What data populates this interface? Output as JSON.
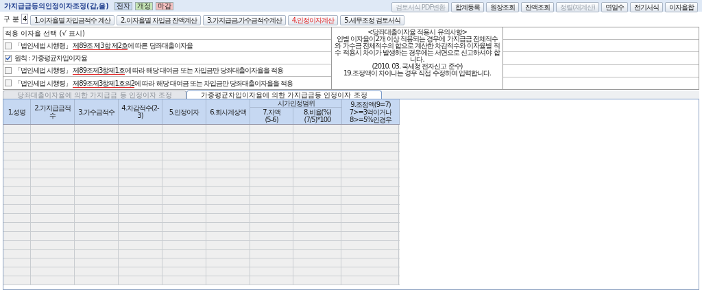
{
  "title": "가지급금등의인정이자조정(갑,을)",
  "badges": [
    {
      "label": "전자",
      "color": "#c8d8f0"
    },
    {
      "label": "개정",
      "color": "#c8e8b8"
    },
    {
      "label": "마감",
      "color": "#f4c0c0"
    }
  ],
  "right_buttons": [
    {
      "label": "검토서식 PDF변환",
      "disabled": true
    },
    {
      "label": "합계등록",
      "disabled": false
    },
    {
      "label": "원장조회",
      "disabled": false
    },
    {
      "label": "잔액조회",
      "disabled": false
    },
    {
      "label": "정렬(재계산)",
      "disabled": true
    },
    {
      "label": "연일수",
      "disabled": false
    },
    {
      "label": "전기서식",
      "disabled": false
    },
    {
      "label": "이자율합",
      "disabled": false
    }
  ],
  "division": {
    "label": "구 분",
    "value": "4"
  },
  "steps": [
    {
      "label": "1.이자율별 차입금적수 계산",
      "selected": false
    },
    {
      "label": "2.이자율별 차입금 잔액계산",
      "selected": false
    },
    {
      "label": "3.가지급금,가수금적수계산",
      "selected": false
    },
    {
      "label": "4.인정이자계산",
      "selected": true
    },
    {
      "label": "5.세무조정 검토서식",
      "selected": false
    }
  ],
  "rate_select": {
    "heading": "적용 이자율 선택 (√ 표시)",
    "options": [
      {
        "checked": false,
        "prefix": "「법인세법 시행령」 ",
        "ref": "제89조 제3항 제2호",
        "rest": "에 따른 당좌대출이자율"
      },
      {
        "checked": true,
        "prefix": "원칙 : 가중평균차입이자율"
      },
      {
        "checked": false,
        "prefix": "「법인세법 시행령」 ",
        "ref": "제89조제3항제1호",
        "rest": "에 따라 해당 대여금 또는 차입금만 당좌대출이자율을 적용"
      },
      {
        "checked": false,
        "prefix": "「법인세법 시행령」 ",
        "ref": "제89조제3항제1호의2",
        "rest": "에 따라 해당 대여금 또는 차입금만 당좌대출이자율을 적용"
      }
    ]
  },
  "note": "<당좌대출이자율 적용시 유의사항>\n인별 이자율이2개 이상 적용되는 경우에 가지급금 전체적수와 가수금 전체적수의 합으로 계산한 차감적수와 이자율별 적수 적용시 차이가 발생하는 경우에는 서면으로 신고하셔야 합니다.\n(2010. 03. 국세청 전자신고 준수)\n19.조정액이 차이나는 경우 직접 수정하여 입력합니다.",
  "tabs": [
    {
      "label": "당좌대출이자율에 의한 가지급금 등 인정이자 조정",
      "selected": false
    },
    {
      "label": "가중평균차입이자율에 의한 가지급금등 인정이자 조정",
      "selected": true
    }
  ],
  "table": {
    "columns": [
      "1.성명",
      "2.가지급금적수",
      "3.가수금적수",
      "4.차감적수(2-3)",
      "5.인정이자",
      "6.회사계상액"
    ],
    "group": "시가인정범위",
    "group_columns": [
      "7.차액\n(5-6)",
      "8.비율(%)\n(7/5)*100"
    ],
    "last_column": "9.조정액(9=7)\n7>=3억이거나\n8>=5%인경우"
  }
}
